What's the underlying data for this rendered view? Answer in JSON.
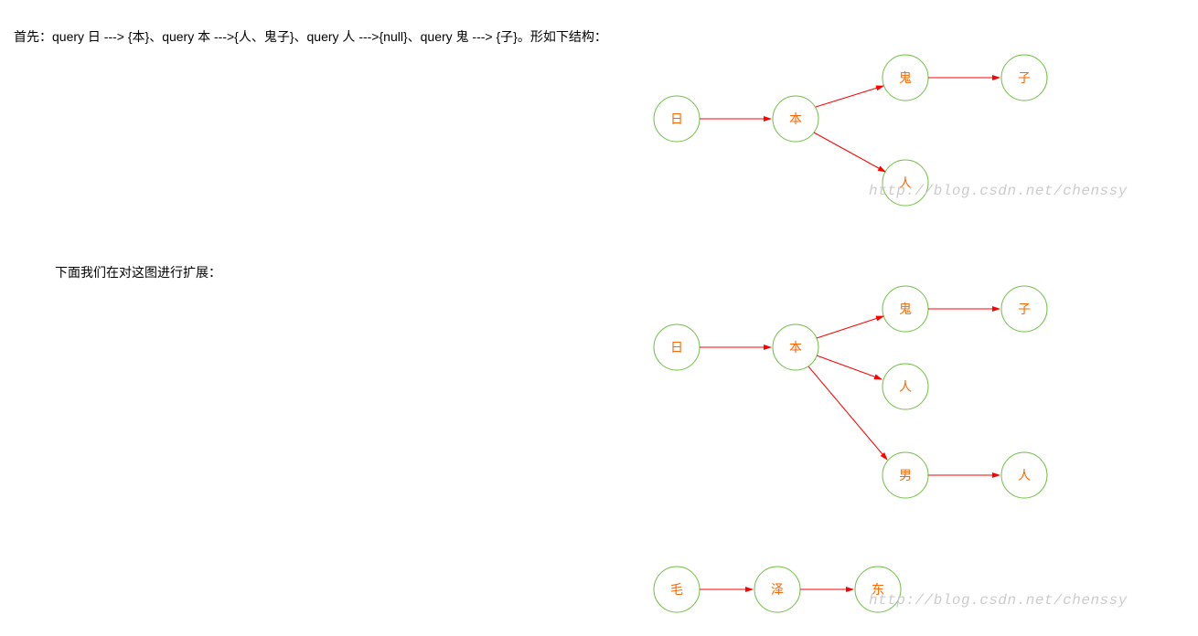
{
  "text1": "首先：query 日 ---> {本}、query 本 --->{人、鬼子}、query 人 --->{null}、query 鬼 ---> {子}。形如下结构：",
  "text2": "下面我们在对这图进行扩展：",
  "watermark": "http://blog.csdn.net/chenssy",
  "diagram1": {
    "nodes": {
      "n1": "日",
      "n2": "本",
      "n3": "鬼",
      "n4": "子",
      "n5": "人"
    }
  },
  "diagram2": {
    "nodes": {
      "n1": "日",
      "n2": "本",
      "n3": "鬼",
      "n4": "子",
      "n5": "人",
      "n6": "男",
      "n7": "人",
      "n8": "毛",
      "n9": "泽",
      "n10": "东"
    }
  }
}
